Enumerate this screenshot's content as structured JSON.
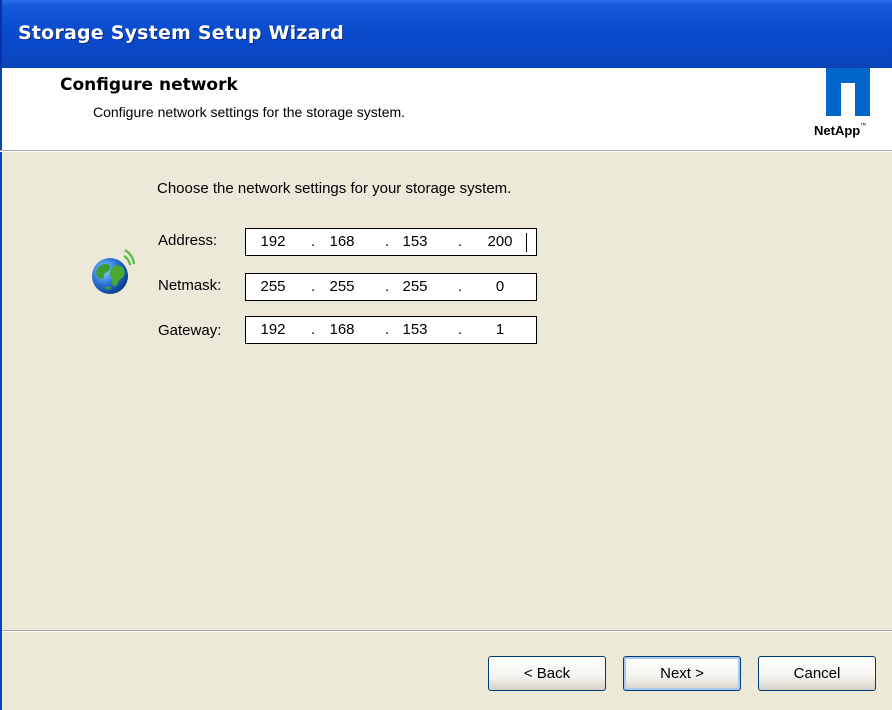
{
  "window": {
    "title": "Storage System Setup Wizard"
  },
  "header": {
    "title": "Configure network",
    "subtitle": "Configure network settings for the storage system.",
    "logo_text": "NetApp",
    "logo_tm": "™"
  },
  "content": {
    "instructions": "Choose the network settings for your storage system.",
    "icon": "network-globe-icon",
    "fields": [
      {
        "label": "Address:",
        "octets": [
          "192",
          "168",
          "153",
          "200"
        ],
        "focused": true
      },
      {
        "label": "Netmask:",
        "octets": [
          "255",
          "255",
          "255",
          "0"
        ],
        "focused": false
      },
      {
        "label": "Gateway:",
        "octets": [
          "192",
          "168",
          "153",
          "1"
        ],
        "focused": false
      }
    ],
    "separator": "."
  },
  "buttons": {
    "back": "< Back",
    "next": "Next >",
    "cancel": "Cancel"
  },
  "colors": {
    "titlebar": "#0a4ccd",
    "dialog_bg": "#ece9d8",
    "logo_blue": "#0066cc"
  }
}
